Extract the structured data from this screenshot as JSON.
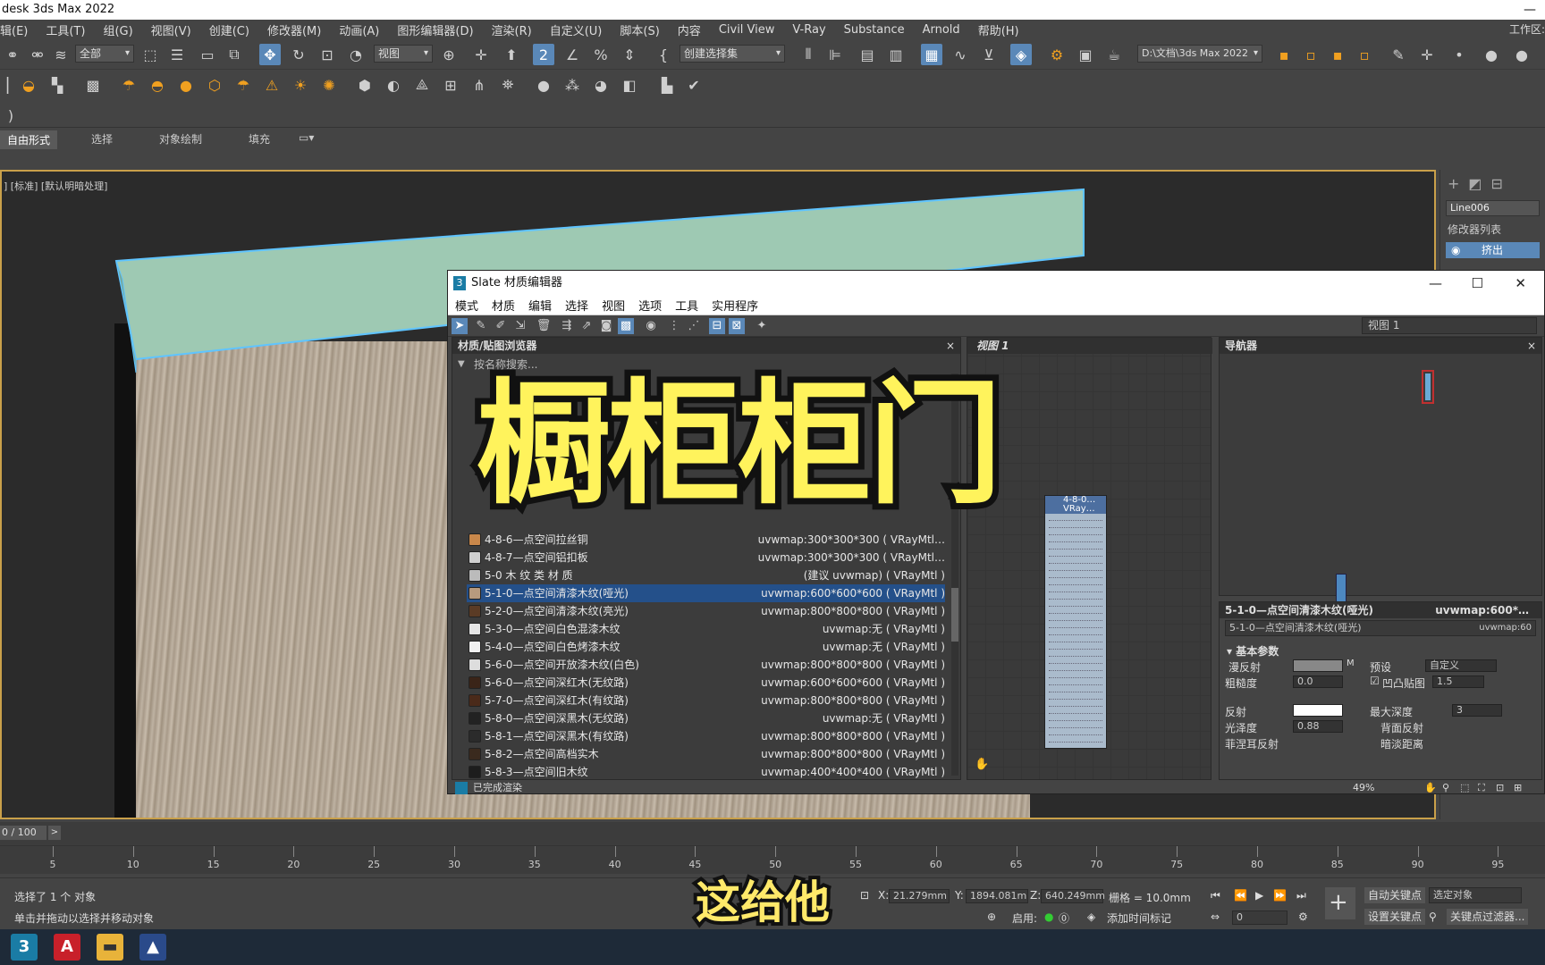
{
  "app": {
    "title": "desk 3ds Max 2022",
    "workspace_label": "工作区:"
  },
  "menu": [
    "辑(E)",
    "工具(T)",
    "组(G)",
    "视图(V)",
    "创建(C)",
    "修改器(M)",
    "动画(A)",
    "图形编辑器(D)",
    "渲染(R)",
    "自定义(U)",
    "脚本(S)",
    "内容",
    "Civil View",
    "V-Ray",
    "Substance",
    "Arnold",
    "帮助(H)"
  ],
  "toolbar": {
    "filter_select": "全部",
    "ref_coord": "视图",
    "named_selection": "创建选择集",
    "project_path": "D:\\文档\\3ds Max 2022"
  },
  "ribbon": {
    "tabs": [
      "自由形式",
      "选择",
      "对象绘制",
      "填充"
    ]
  },
  "viewport": {
    "label": "] [标准] [默认明暗处理]"
  },
  "right_panel": {
    "object_name": "Line006",
    "modifier_list": "修改器列表",
    "modifier": "挤出"
  },
  "slate": {
    "title": "Slate 材质编辑器",
    "menu": [
      "模式",
      "材质",
      "编辑",
      "选择",
      "视图",
      "选项",
      "工具",
      "实用程序"
    ],
    "view_select": "视图 1",
    "browser_title": "材质/贴图浏览器",
    "search_placeholder": "按名称搜索...",
    "materials": [
      {
        "name": "4-8-6—点空间拉丝铜",
        "info": "uvwmap:300*300*300 ( VRayMtl…",
        "color": "#c8874a"
      },
      {
        "name": "4-8-7—点空间铝扣板",
        "info": "uvwmap:300*300*300 ( VRayMtl…",
        "color": "#cfcfcf"
      },
      {
        "name": "5-0        木 纹 类 材 质",
        "info": "(建议 uvwmap) ( VRayMtl )",
        "color": "#bbbbbb"
      },
      {
        "name": "5-1-0—点空间清漆木纹(哑光)",
        "info": "uvwmap:600*600*600 ( VRayMtl )",
        "color": "#b79a7e"
      },
      {
        "name": "5-2-0—点空间清漆木纹(亮光)",
        "info": "uvwmap:800*800*800 ( VRayMtl )",
        "color": "#5a3b25"
      },
      {
        "name": "5-3-0—点空间白色混漆木纹",
        "info": "uvwmap:无 ( VRayMtl )",
        "color": "#e5e5e5"
      },
      {
        "name": "5-4-0—点空间白色烤漆木纹",
        "info": "uvwmap:无 ( VRayMtl )",
        "color": "#f0f0f0"
      },
      {
        "name": "5-6-0—点空间开放漆木纹(白色)",
        "info": "uvwmap:800*800*800 ( VRayMtl )",
        "color": "#dddddd"
      },
      {
        "name": "5-6-0—点空间深红木(无纹路)",
        "info": "uvwmap:600*600*600 ( VRayMtl )",
        "color": "#3a2418"
      },
      {
        "name": "5-7-0—点空间深红木(有纹路)",
        "info": "uvwmap:800*800*800 ( VRayMtl )",
        "color": "#4a2a1a"
      },
      {
        "name": "5-8-0—点空间深黑木(无纹路)",
        "info": "uvwmap:无 ( VRayMtl )",
        "color": "#222222"
      },
      {
        "name": "5-8-1—点空间深黑木(有纹路)",
        "info": "uvwmap:800*800*800 ( VRayMtl )",
        "color": "#2b2b2b"
      },
      {
        "name": "5-8-2—点空间高档实木",
        "info": "uvwmap:800*800*800 ( VRayMtl )",
        "color": "#3a2a1e"
      },
      {
        "name": "5-8-3—点空间旧木纹",
        "info": "uvwmap:400*400*400 ( VRayMtl )",
        "color": "#1d1d1d"
      }
    ],
    "view1_tab": "视图 1",
    "navigator_title": "导航器",
    "node_title": "4-8-0…",
    "node_subtitle": "VRay…",
    "props": {
      "header": "5-1-0—点空间清漆木纹(哑光)",
      "header_right": "uvwmap:600*…",
      "name": "5-1-0—点空间清漆木纹(哑光)",
      "name_right": "uvwmap:60",
      "section": "基本参数",
      "diffuse": "漫反射",
      "preset": "预设",
      "preset_value": "自定义",
      "roughness": "粗糙度",
      "roughness_value": "0.0",
      "bump": "凹凸贴图",
      "bump_value": "1.5",
      "reflect": "反射",
      "max_depth": "最大深度",
      "max_depth_value": "3",
      "gloss": "光泽度",
      "gloss_value": "0.88",
      "back_reflect": "背面反射",
      "fresnel": "菲涅耳反射",
      "dim_dist": "暗淡距离"
    },
    "status": "已完成渲染",
    "zoom": "49%"
  },
  "timeline": {
    "frame": "0 / 100",
    "ticks": [
      "5",
      "10",
      "15",
      "20",
      "25",
      "30",
      "35",
      "40",
      "45",
      "50",
      "55",
      "60",
      "65",
      "70",
      "75",
      "80",
      "85",
      "90",
      "95"
    ]
  },
  "status": {
    "selected": "选择了 1 个 对象",
    "hint": "单击并拖动以选择并移动对象",
    "x_label": "X:",
    "x": "21.279mm",
    "y_label": "Y:",
    "y": "1894.081m",
    "z_label": "Z:",
    "z": "640.249mm",
    "grid": "栅格 = 10.0mm",
    "enable": "启用:",
    "add_time_tag": "添加时间标记",
    "auto_key": "自动关键点",
    "set_key": "设置关键点",
    "selected_obj": "选定对象",
    "key_filter": "关键点过滤器...",
    "frame_value": "0"
  },
  "overlay": {
    "title": "橱柜柜门",
    "subtitle": "这给他"
  }
}
